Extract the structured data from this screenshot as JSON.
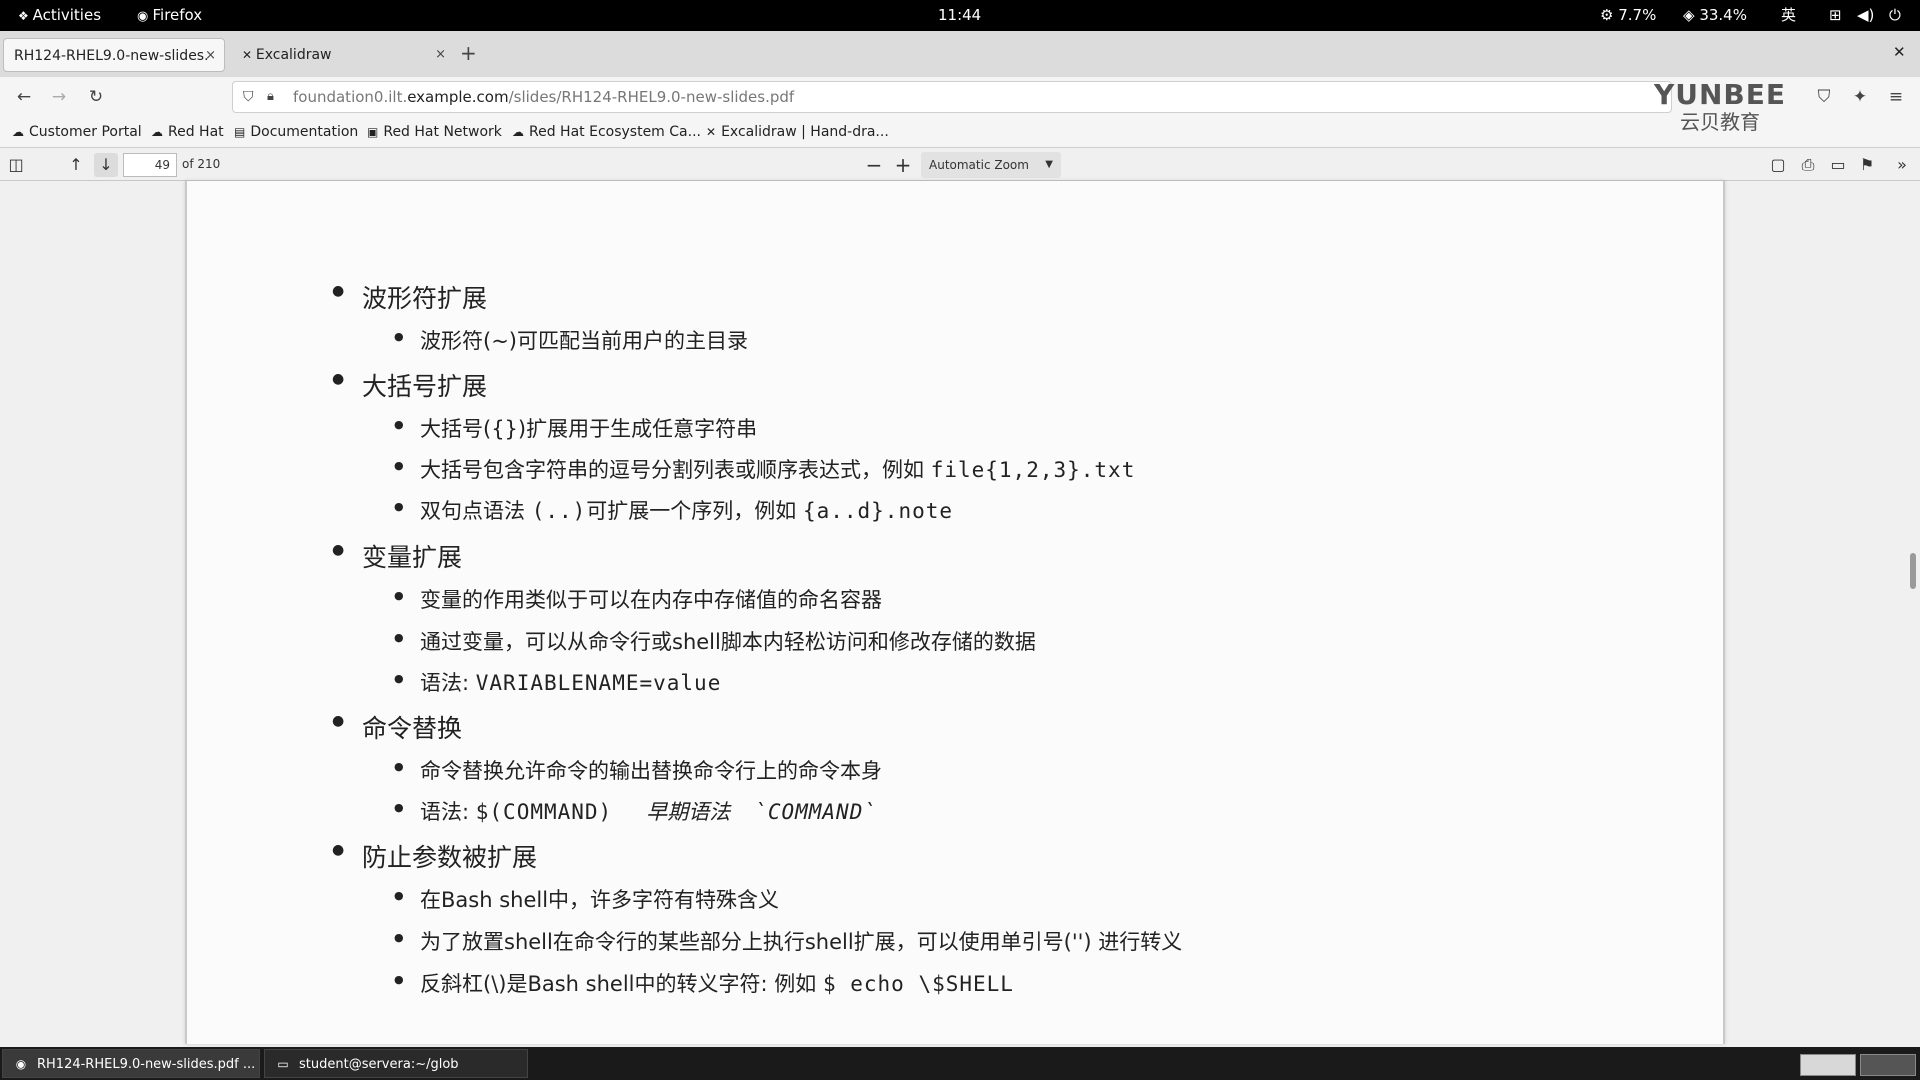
{
  "system_bar": {
    "activities": "Activities",
    "app_name": "Firefox",
    "clock": "11:44",
    "cpu": "7.7%",
    "mem": "33.4%",
    "input_method": "英"
  },
  "tabs": [
    {
      "title": "RH124-RHEL9.0-new-slides.",
      "close": "×"
    },
    {
      "title": "Excalidraw",
      "close": "×"
    }
  ],
  "new_tab": "+",
  "url": {
    "prefix": "foundation0.ilt.",
    "domain": "example.com",
    "path": "/slides/RH124-RHEL9.0-new-slides.pdf"
  },
  "bookmarks": [
    {
      "label": "Customer Portal",
      "icon": "redhat-icon"
    },
    {
      "label": "Red Hat",
      "icon": "redhat-icon"
    },
    {
      "label": "Documentation",
      "icon": "doc-icon"
    },
    {
      "label": "Red Hat Network",
      "icon": "network-icon"
    },
    {
      "label": "Red Hat Ecosystem Ca...",
      "icon": "redhat-icon"
    },
    {
      "label": "Excalidraw | Hand-dra...",
      "icon": "excalidraw-icon"
    }
  ],
  "pdf_toolbar": {
    "page_number": "49",
    "page_count": "of 210",
    "zoom": "Automatic Zoom",
    "zoom_out": "−",
    "zoom_in": "+"
  },
  "slide": {
    "s1": {
      "heading": "波形符扩展",
      "b1": "波形符(~)可匹配当前用户的主目录"
    },
    "s2": {
      "heading": "大括号扩展",
      "b1": "大括号({})扩展用于生成任意字符串",
      "b2_text": "大括号包含字符串的逗号分割列表或顺序表达式，例如 ",
      "b2_code": "file{1,2,3}.txt",
      "b3_text": "双句点语法 ",
      "b3_code1": "(..)",
      "b3_text2": "可扩展一个序列，例如 ",
      "b3_code2": "{a..d}.note"
    },
    "s3": {
      "heading": "变量扩展",
      "b1": "变量的作用类似于可以在内存中存储值的命名容器",
      "b2": "通过变量，可以从命令行或shell脚本内轻松访问和修改存储的数据",
      "b3_text": "语法: ",
      "b3_code": "VARIABLENAME=value"
    },
    "s4": {
      "heading": "命令替换",
      "b1": "命令替换允许命令的输出替换命令行上的命令本身",
      "b2_text": "语法: ",
      "b2_code": "$(COMMAND)",
      "b2_ital": "早期语法",
      "b2_code2": "`COMMAND`"
    },
    "s5": {
      "heading": "防止参数被扩展",
      "b1": "在Bash shell中，许多字符有特殊含义",
      "b2": "为了放置shell在命令行的某些部分上执行shell扩展，可以使用单引号('') 进行转义",
      "b3_text": "反斜杠(\\)是Bash shell中的转义字符: 例如 ",
      "b3_code": "$ echo \\$SHELL"
    }
  },
  "watermark": {
    "en": "YUNBEE",
    "cn": "云贝教育"
  },
  "taskbar": [
    {
      "label": "RH124-RHEL9.0-new-slides.pdf ...",
      "icon": "firefox-icon"
    },
    {
      "label": "student@servera:~/glob",
      "icon": "terminal-icon"
    }
  ]
}
